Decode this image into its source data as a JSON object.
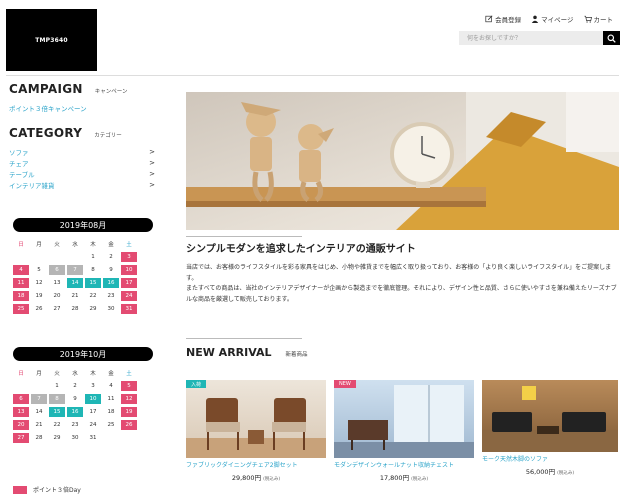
{
  "logo": "TMP3640",
  "topnav": {
    "register": "会員登録",
    "mypage": "マイページ",
    "cart": "カート"
  },
  "search": {
    "placeholder": "何をお探しですか？"
  },
  "campaign": {
    "title": "CAMPAIGN",
    "subtitle": "キャンペーン",
    "link": "ポイント３倍キャンペーン"
  },
  "category": {
    "title": "CATEGORY",
    "subtitle": "カテゴリー",
    "items": [
      "ソファ",
      "チェア",
      "テーブル",
      "インテリア雑貨"
    ]
  },
  "weekdays": [
    "日",
    "月",
    "火",
    "水",
    "木",
    "金",
    "土"
  ],
  "calendars": [
    {
      "caption": "2019年08月",
      "weeks": [
        [
          [
            "",
            ""
          ],
          [
            "",
            ""
          ],
          [
            "",
            ""
          ],
          [
            "",
            ""
          ],
          [
            "1",
            ""
          ],
          [
            "2",
            ""
          ],
          [
            "3",
            "h"
          ]
        ],
        [
          [
            "4",
            "h"
          ],
          [
            "5",
            ""
          ],
          [
            "6",
            "g"
          ],
          [
            "7",
            "g"
          ],
          [
            "8",
            ""
          ],
          [
            "9",
            ""
          ],
          [
            "10",
            "h"
          ]
        ],
        [
          [
            "11",
            "h"
          ],
          [
            "12",
            ""
          ],
          [
            "13",
            ""
          ],
          [
            "14",
            "t"
          ],
          [
            "15",
            "t"
          ],
          [
            "16",
            "t"
          ],
          [
            "17",
            "h"
          ]
        ],
        [
          [
            "18",
            "h"
          ],
          [
            "19",
            ""
          ],
          [
            "20",
            ""
          ],
          [
            "21",
            ""
          ],
          [
            "22",
            ""
          ],
          [
            "23",
            ""
          ],
          [
            "24",
            "h"
          ]
        ],
        [
          [
            "25",
            "h"
          ],
          [
            "26",
            ""
          ],
          [
            "27",
            ""
          ],
          [
            "28",
            ""
          ],
          [
            "29",
            ""
          ],
          [
            "30",
            ""
          ],
          [
            "31",
            "h"
          ]
        ]
      ]
    },
    {
      "caption": "2019年10月",
      "weeks": [
        [
          [
            "",
            ""
          ],
          [
            "",
            ""
          ],
          [
            "1",
            ""
          ],
          [
            "2",
            ""
          ],
          [
            "3",
            ""
          ],
          [
            "4",
            ""
          ],
          [
            "5",
            "h"
          ]
        ],
        [
          [
            "6",
            "h"
          ],
          [
            "7",
            "g"
          ],
          [
            "8",
            "g"
          ],
          [
            "9",
            ""
          ],
          [
            "10",
            "t"
          ],
          [
            "11",
            ""
          ],
          [
            "12",
            "h"
          ]
        ],
        [
          [
            "13",
            "h"
          ],
          [
            "14",
            ""
          ],
          [
            "15",
            "t"
          ],
          [
            "16",
            "t"
          ],
          [
            "17",
            ""
          ],
          [
            "18",
            ""
          ],
          [
            "19",
            "h"
          ]
        ],
        [
          [
            "20",
            "h"
          ],
          [
            "21",
            ""
          ],
          [
            "22",
            ""
          ],
          [
            "23",
            ""
          ],
          [
            "24",
            ""
          ],
          [
            "25",
            ""
          ],
          [
            "26",
            "h"
          ]
        ],
        [
          [
            "27",
            "h"
          ],
          [
            "28",
            ""
          ],
          [
            "29",
            ""
          ],
          [
            "30",
            ""
          ],
          [
            "31",
            ""
          ],
          [
            "",
            ""
          ],
          [
            "",
            ""
          ]
        ]
      ]
    }
  ],
  "legend": "ポイント３倍Day",
  "article": {
    "title": "シンプルモダンを追求したインテリアの通販サイト",
    "body1": "当店では、お客様のライフスタイルを彩る家具をはじめ、小物や雑貨までを幅広く取り扱っており、お客様の「より良く楽しいライフスタイル」をご提案します。",
    "body2": "またすべての商品は、当社のインテリアデザイナーが企画から製造までを徹底管理。それにより、デザイン性と品質、さらに使いやすさを兼ね備えたリーズナブルな商品を厳選して販売しております。"
  },
  "new_arrival": {
    "title": "NEW ARRIVAL",
    "subtitle": "新着商品"
  },
  "products": [
    {
      "badge": "入荷",
      "name": "ファブリックダイニングチェア2脚セット",
      "price": "29,800円",
      "tax": "(税込み)"
    },
    {
      "badge": "NEW",
      "name": "モダンデザインウォールナット収納チェスト",
      "price": "17,800円",
      "tax": "(税込み)"
    },
    {
      "badge": "",
      "name": "モーク天然木脚のソファ",
      "price": "56,000円",
      "tax": "(税込み)"
    }
  ],
  "colors": {
    "holiday": "#e34b72",
    "event": "#1fb6b5",
    "closed": "#b5b5b5",
    "link": "#2aa3c9",
    "badge_new": "#e34b72",
    "badge_arrival": "#1fb6b5"
  }
}
